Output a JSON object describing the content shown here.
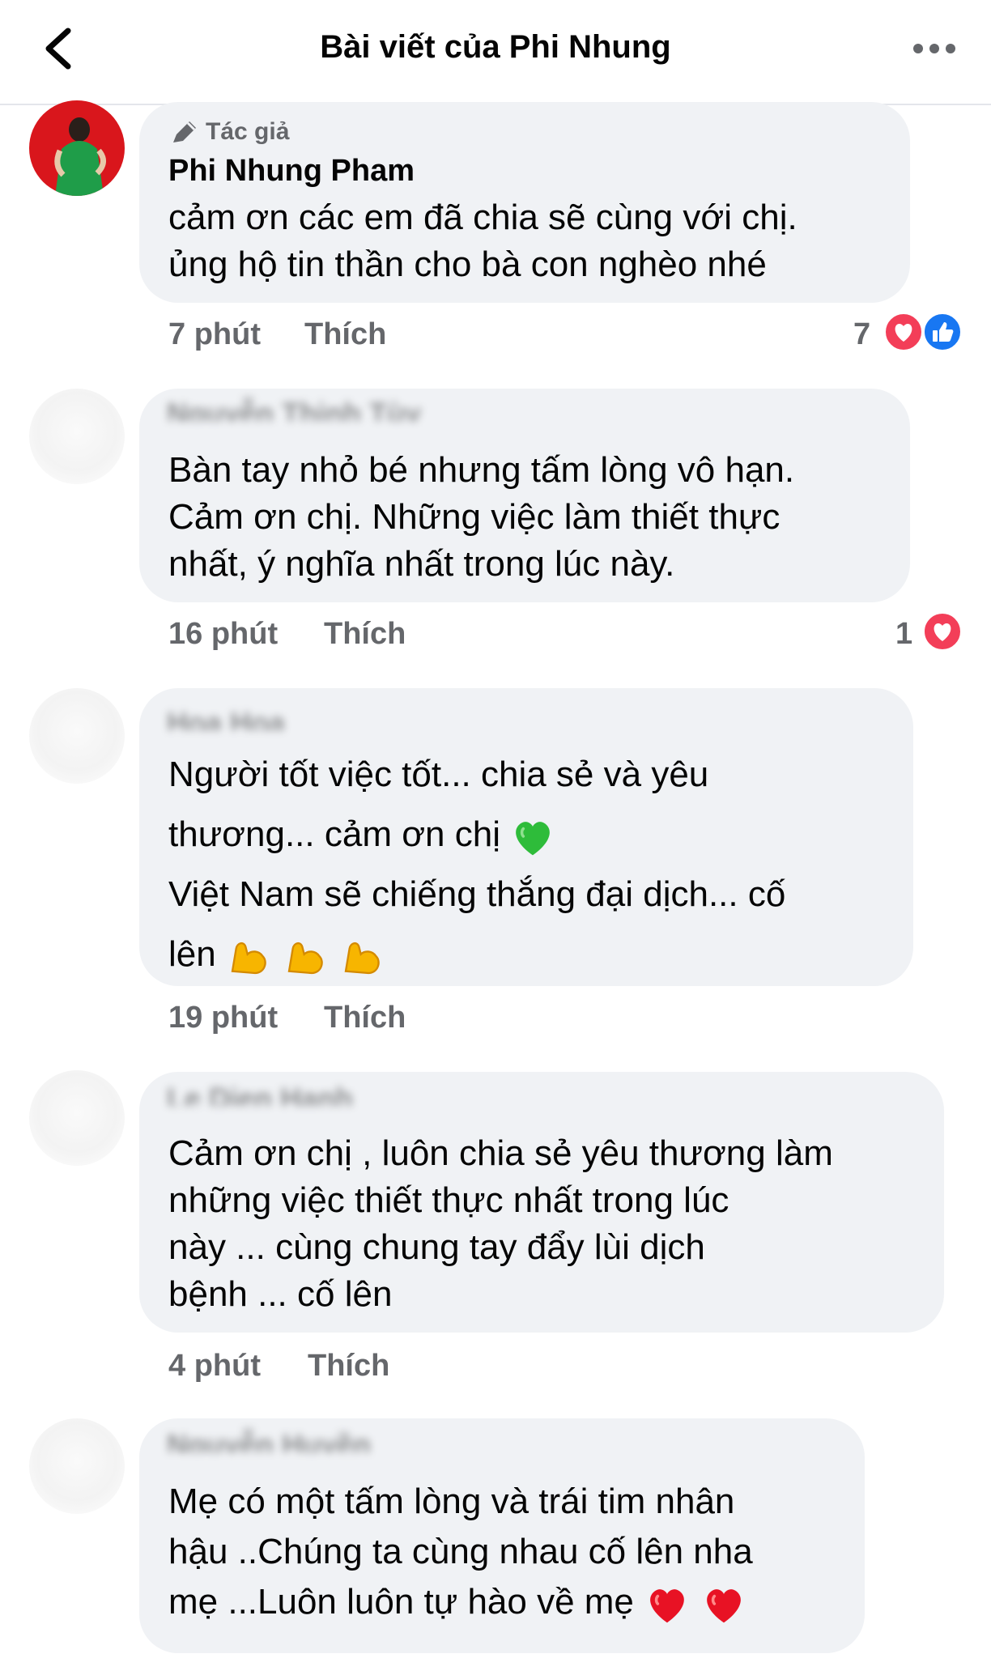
{
  "header": {
    "title": "Bài viết của Phi Nhung"
  },
  "comments": [
    {
      "badge": "Tác giả",
      "author": "Phi Nhung Pham",
      "lines": [
        "cảm ơn các em đã chia sẽ cùng với chị.",
        "ủng hộ tin thần cho bà con nghèo nhé"
      ],
      "time": "7 phút",
      "like_label": "Thích",
      "reaction_count": "7",
      "reactions": [
        "heart-icon",
        "like-icon"
      ]
    },
    {
      "lines": [
        "Bàn tay nhỏ bé nhưng tấm lòng vô hạn.",
        "Cảm ơn chị. Những việc làm thiết thực",
        "nhất, ý nghĩa nhất trong lúc này."
      ],
      "time": "16 phút",
      "like_label": "Thích",
      "reaction_count": "1",
      "reactions": [
        "heart-icon"
      ]
    },
    {
      "lines": [
        "Người tốt việc tốt... chia sẻ và yêu",
        "thương... cảm ơn chị",
        "Việt Nam sẽ chiếng thắng đại dịch... cố",
        "lên"
      ],
      "time": "19 phút",
      "like_label": "Thích",
      "emojis": [
        "green-heart-emoji",
        "flexed-biceps-emoji"
      ]
    },
    {
      "lines": [
        "Cảm ơn chị , luôn chia sẻ yêu thương làm",
        "những việc thiết thực nhất trong lúc",
        "này ... cùng chung tay đẩy lùi dịch",
        "bệnh ... cố lên"
      ],
      "time": "4 phút",
      "like_label": "Thích"
    },
    {
      "lines": [
        "Mẹ có một tấm lòng và trái tim nhân",
        "hậu ..Chúng ta cùng nhau cố lên nha",
        "mẹ ...Luôn luôn tự hào về mẹ"
      ],
      "emojis": [
        "red-heart-emoji"
      ]
    }
  ],
  "colors": {
    "bubble": "#f0f2f5",
    "meta_text": "#65676b",
    "heart": "#f33e58",
    "like": "#1877f2"
  }
}
